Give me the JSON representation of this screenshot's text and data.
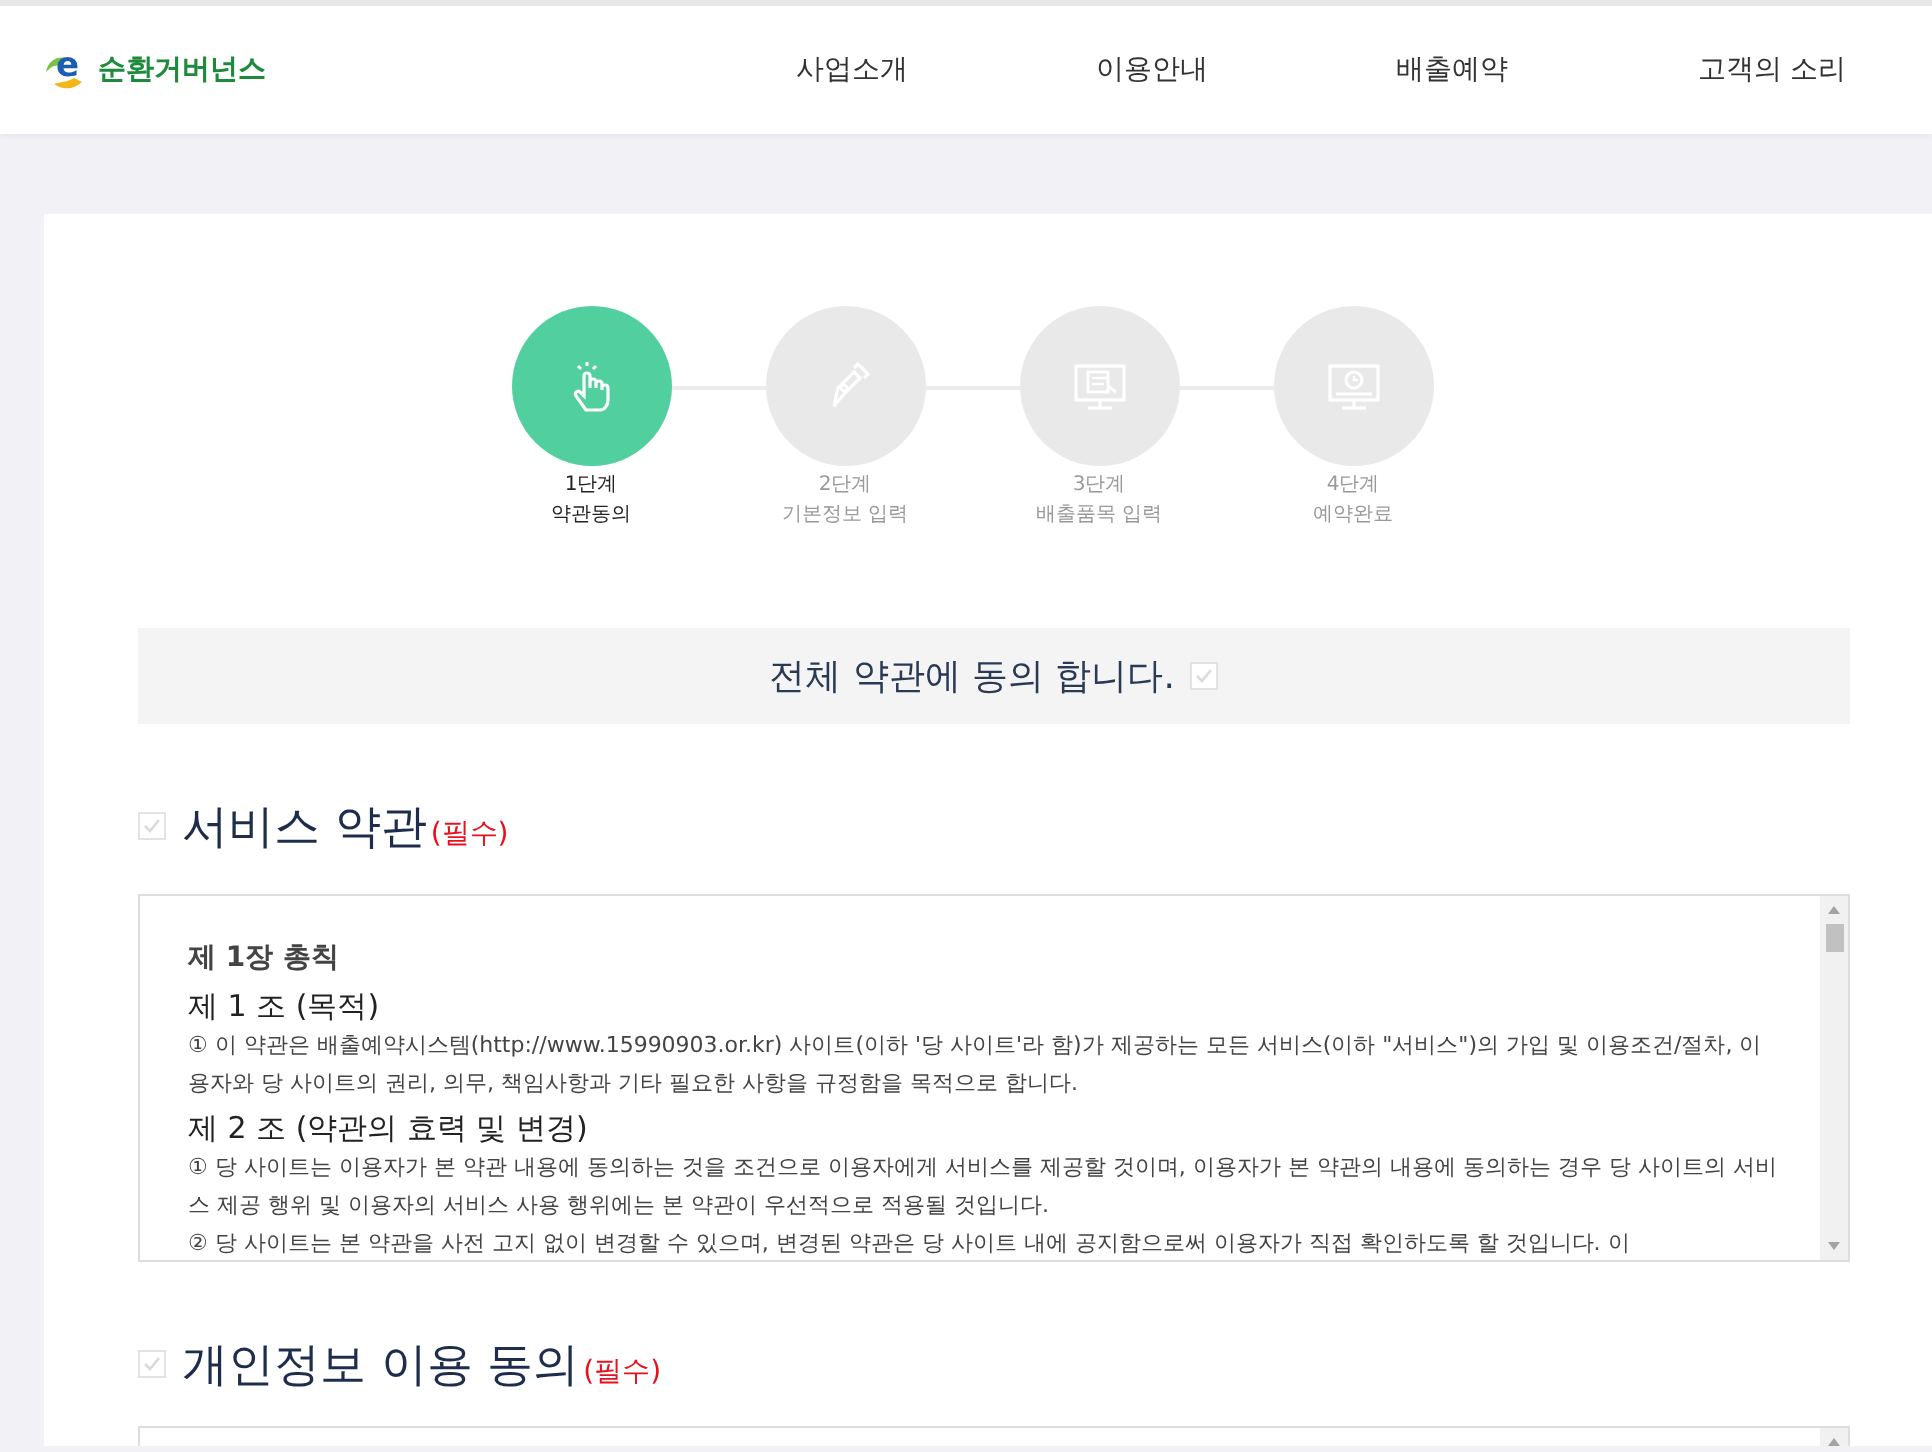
{
  "header": {
    "logo_mark": "e",
    "logo_text": "순환거버넌스",
    "nav": [
      {
        "label": "사업소개"
      },
      {
        "label": "이용안내"
      },
      {
        "label": "배출예약"
      },
      {
        "label": "고객의 소리"
      }
    ]
  },
  "steps": [
    {
      "kind": "hand",
      "step": "1단계",
      "label": "약관동의",
      "selected": true
    },
    {
      "kind": "pen",
      "step": "2단계",
      "label": "기본정보 입력",
      "selected": false
    },
    {
      "kind": "monitor-doc",
      "step": "3단계",
      "label": "배출품목 입력",
      "selected": false
    },
    {
      "kind": "monitor-clock",
      "step": "4단계",
      "label": "예약완료",
      "selected": false
    }
  ],
  "agree_all": {
    "label": "전체 약관에 동의 합니다.",
    "checked": false
  },
  "sections": [
    {
      "title": "서비스 약관",
      "required": "(필수)",
      "checked": false,
      "content": [
        {
          "kind": "chapter",
          "text": "제 1장 총칙"
        },
        {
          "kind": "article",
          "text": "제 1 조 (목적)"
        },
        {
          "kind": "para",
          "text": "① 이 약관은 배출예약시스템(http://www.15990903.or.kr) 사이트(이하 '당 사이트'라 함)가 제공하는 모든 서비스(이하 \"서비스\")의 가입 및 이용조건/절차, 이용자와 당 사이트의 권리, 의무, 책임사항과 기타 필요한 사항을 규정함을 목적으로 합니다."
        },
        {
          "kind": "article",
          "text": "제 2 조 (약관의 효력 및 변경)"
        },
        {
          "kind": "para",
          "text": "① 당 사이트는 이용자가 본 약관 내용에 동의하는 것을 조건으로 이용자에게 서비스를 제공할 것이며, 이용자가 본 약관의 내용에 동의하는 경우 당 사이트의 서비스 제공 행위 및 이용자의 서비스 사용 행위에는 본 약관이 우선적으로 적용될 것입니다."
        },
        {
          "kind": "para",
          "text": "② 당 사이트는 본 약관을 사전 고지 없이 변경할 수 있으며, 변경된 약관은 당 사이트 내에 공지함으로써 이용자가 직접 확인하도록 할 것입니다. 이"
        }
      ]
    },
    {
      "title": "개인정보 이용 동의",
      "required": "(필수)",
      "checked": false
    }
  ]
}
